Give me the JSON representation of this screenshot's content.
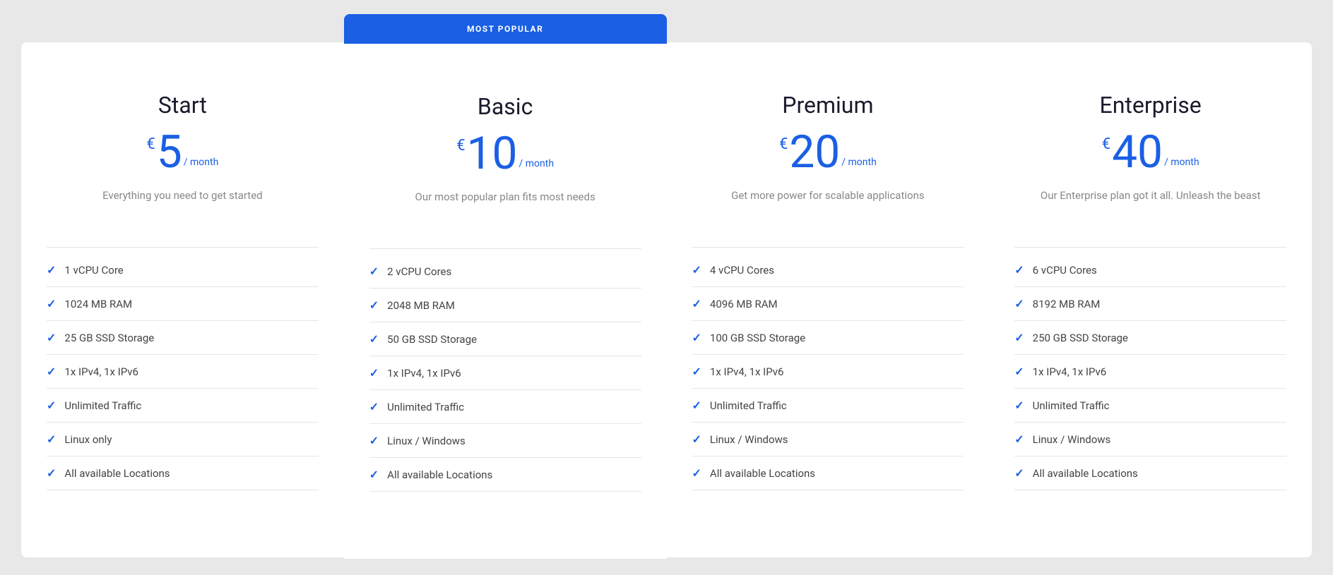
{
  "colors": {
    "accent": "#1a5fe4",
    "text_dark": "#1a1a2e",
    "text_gray": "#888888",
    "text_feature": "#444444",
    "bg_white": "#ffffff",
    "bg_page": "#e8e8e8",
    "divider": "#e5e5e5"
  },
  "plans": [
    {
      "id": "start",
      "name": "Start",
      "popular": false,
      "currency": "€",
      "price": "5",
      "period": "/ month",
      "description": "Everything you need to get started",
      "features": [
        "1 vCPU Core",
        "1024 MB RAM",
        "25 GB SSD Storage",
        "1x IPv4, 1x IPv6",
        "Unlimited Traffic",
        "Linux only",
        "All available Locations"
      ]
    },
    {
      "id": "basic",
      "name": "Basic",
      "popular": true,
      "popular_label": "MOST POPULAR",
      "currency": "€",
      "price": "10",
      "period": "/ month",
      "description": "Our most popular plan fits most needs",
      "features": [
        "2 vCPU Cores",
        "2048 MB RAM",
        "50 GB SSD Storage",
        "1x IPv4, 1x IPv6",
        "Unlimited Traffic",
        "Linux / Windows",
        "All available Locations"
      ]
    },
    {
      "id": "premium",
      "name": "Premium",
      "popular": false,
      "currency": "€",
      "price": "20",
      "period": "/ month",
      "description": "Get more power for scalable applications",
      "features": [
        "4 vCPU Cores",
        "4096 MB RAM",
        "100 GB SSD Storage",
        "1x IPv4, 1x IPv6",
        "Unlimited Traffic",
        "Linux / Windows",
        "All available Locations"
      ]
    },
    {
      "id": "enterprise",
      "name": "Enterprise",
      "popular": false,
      "currency": "€",
      "price": "40",
      "period": "/ month",
      "description": "Our Enterprise plan got it all. Unleash the beast",
      "features": [
        "6 vCPU Cores",
        "8192 MB RAM",
        "250 GB SSD Storage",
        "1x IPv4, 1x IPv6",
        "Unlimited Traffic",
        "Linux / Windows",
        "All available Locations"
      ]
    }
  ]
}
